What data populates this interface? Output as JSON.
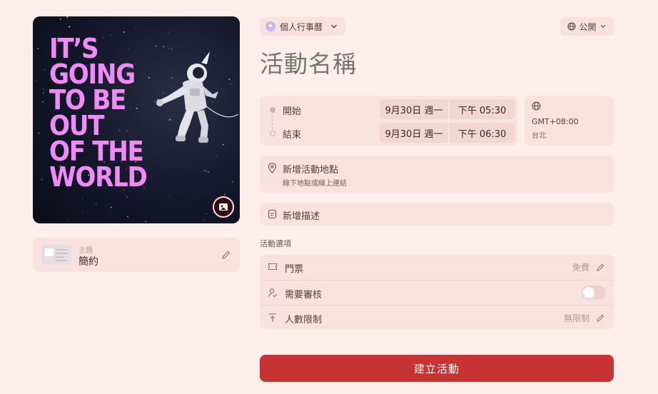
{
  "cover": {
    "headline_lines": [
      "IT’S",
      "GOING",
      "TO BE",
      "OUT",
      "OF THE",
      "WORLD"
    ],
    "headline_color": "#f08bf5"
  },
  "theme": {
    "label": "主題",
    "value": "簡約"
  },
  "calendar": {
    "label": "個人行事曆",
    "icon": "calendar-avatar-icon"
  },
  "visibility": {
    "label": "公開",
    "icon": "globe-icon"
  },
  "event": {
    "name_placeholder": "活動名稱"
  },
  "schedule": {
    "start": {
      "label": "開始",
      "date": "9月30日 週一",
      "time": "下午 05:30"
    },
    "end": {
      "label": "結束",
      "date": "9月30日 週一",
      "time": "下午 06:30"
    }
  },
  "timezone": {
    "offset": "GMT+08:00",
    "city": "台北"
  },
  "location": {
    "title": "新增活動地點",
    "subtitle": "線下地點或線上連結"
  },
  "description": {
    "label": "新增描述"
  },
  "options": {
    "heading": "活動選項",
    "tickets": {
      "label": "門票",
      "value": "免費"
    },
    "approval": {
      "label": "需要審核",
      "enabled": false
    },
    "capacity": {
      "label": "人數限制",
      "value": "無限制"
    }
  },
  "actions": {
    "create_label": "建立活動"
  },
  "colors": {
    "background": "#fdeeeb",
    "accent": "#c73232",
    "card": "#f8e2df"
  }
}
